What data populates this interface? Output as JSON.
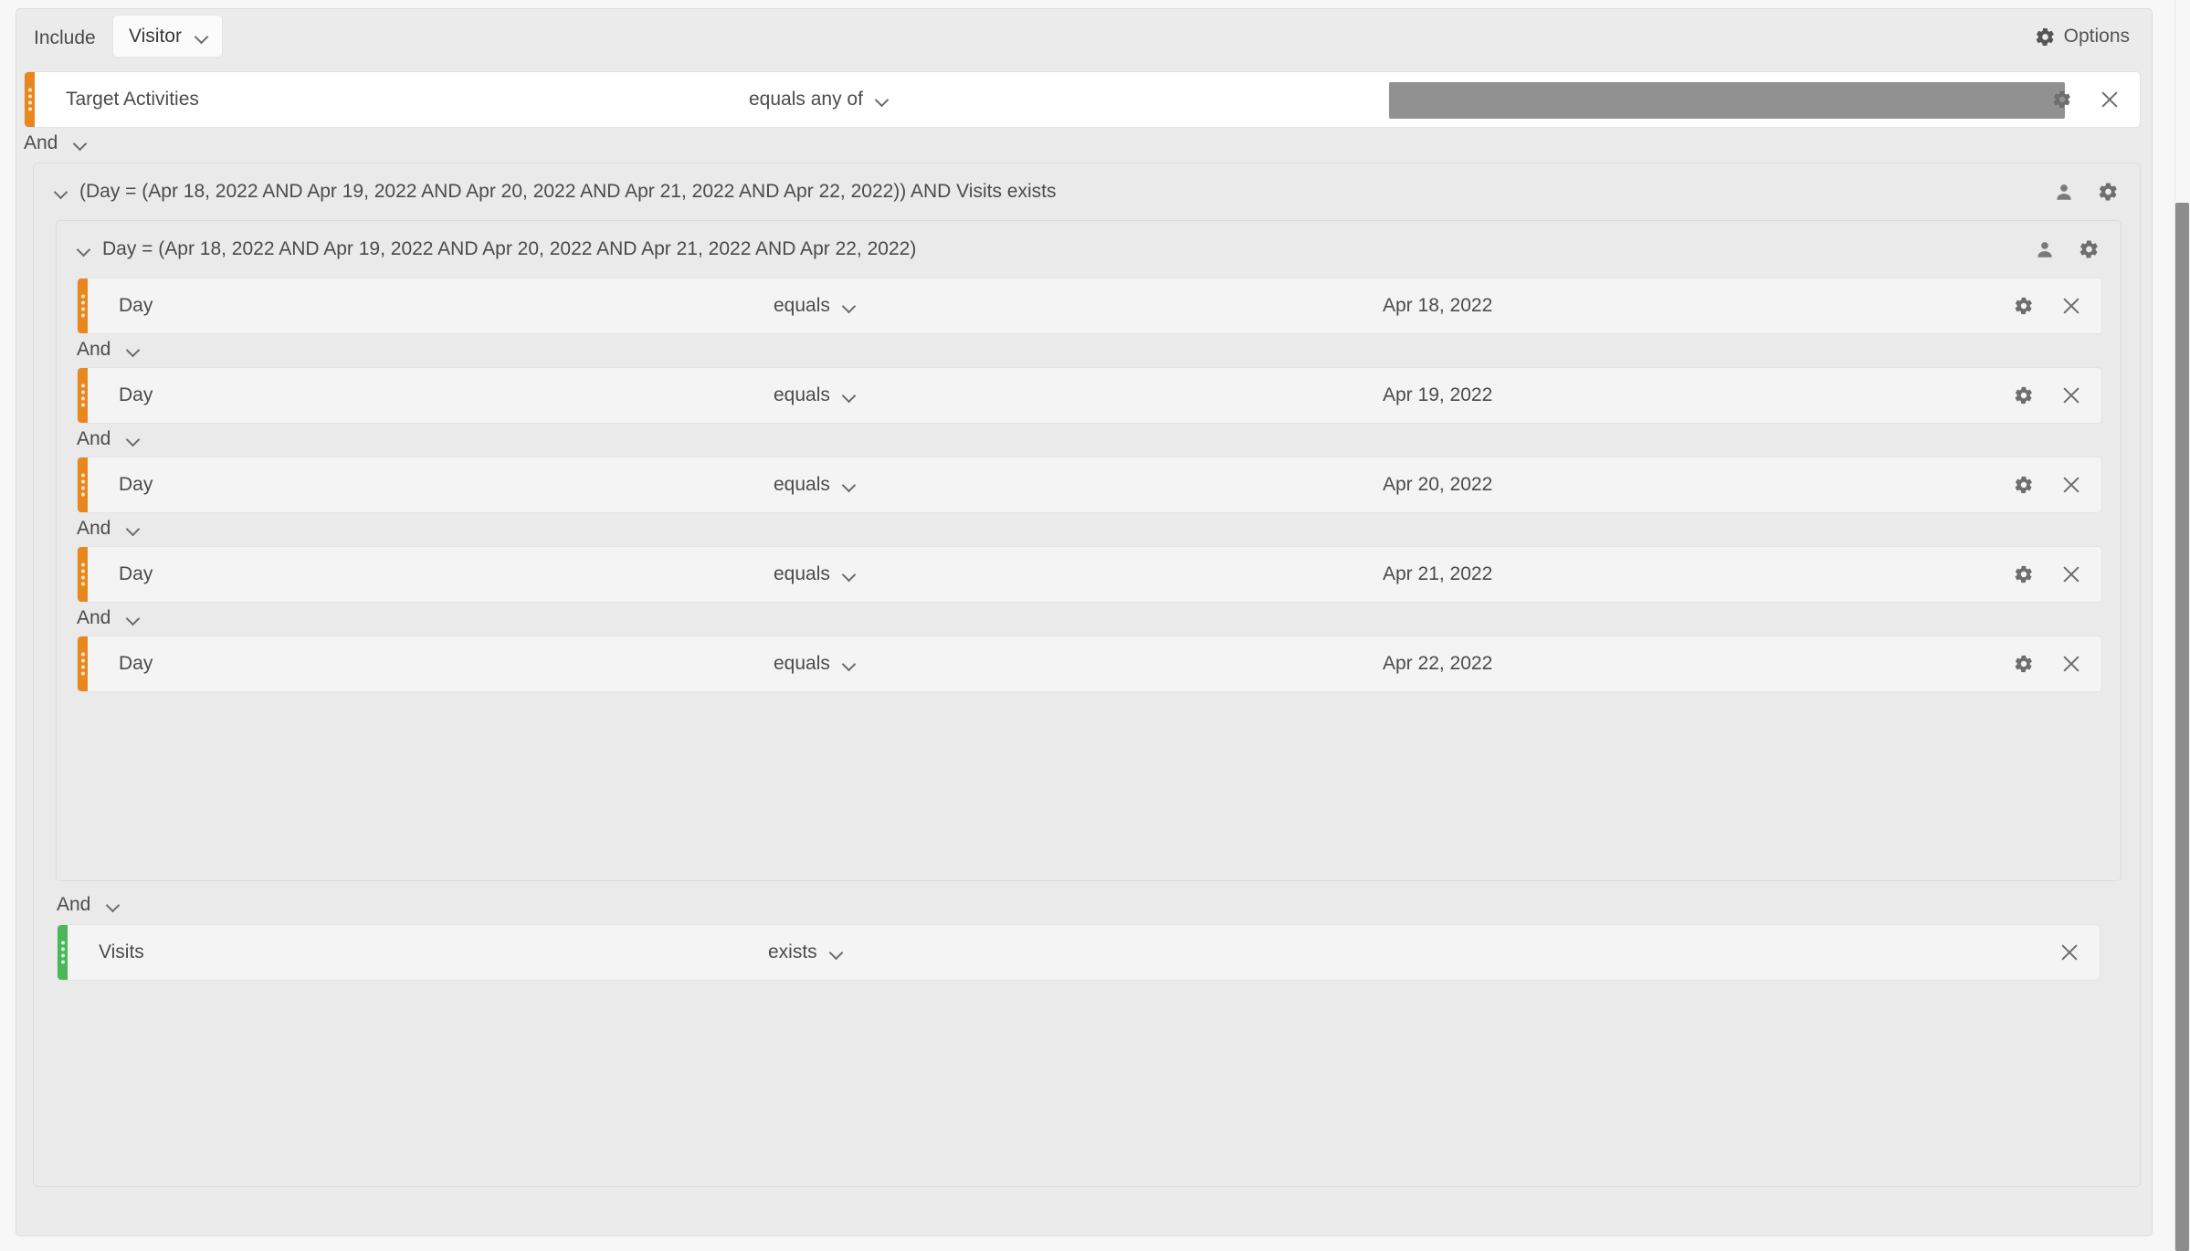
{
  "header": {
    "include_label": "Include",
    "container_value": "Visitor",
    "container_chevron_icon": "chevron-down-icon",
    "options_label": "Options",
    "options_icon": "gear-icon"
  },
  "colors": {
    "orange_bar": "#e8871e",
    "green_bar": "#4bb75a",
    "panel_bg": "#ebebeb",
    "group_bg": "#eaeaea",
    "row_bg": "#ffffff",
    "subrow_bg": "#f4f4f4",
    "redacted_box": "#919191"
  },
  "top_rule": {
    "dimension": "Target Activities",
    "operator": "equals any of",
    "operator_chevron_icon": "chevron-down-icon",
    "value_redacted": true,
    "settings_icon": "gear-icon",
    "remove_icon": "close-icon"
  },
  "connector_top": {
    "label": "And",
    "chevron_icon": "chevron-down-icon"
  },
  "outer_group": {
    "collapse_icon": "chevron-down-icon",
    "title": "(Day = (Apr 18, 2022 AND Apr 19, 2022 AND Apr 20, 2022 AND Apr 21, 2022 AND Apr 22, 2022)) AND Visits exists",
    "person_icon": "person-icon",
    "settings_icon": "gear-icon"
  },
  "inner_group": {
    "collapse_icon": "chevron-down-icon",
    "title": "Day = (Apr 18, 2022 AND Apr 19, 2022 AND Apr 20, 2022 AND Apr 21, 2022 AND Apr 22, 2022)",
    "person_icon": "person-icon",
    "settings_icon": "gear-icon"
  },
  "day_rules": [
    {
      "dimension": "Day",
      "operator": "equals",
      "value": "Apr 18, 2022",
      "settings_icon": "gear-icon",
      "remove_icon": "close-icon",
      "connector": "And"
    },
    {
      "dimension": "Day",
      "operator": "equals",
      "value": "Apr 19, 2022",
      "settings_icon": "gear-icon",
      "remove_icon": "close-icon",
      "connector": "And"
    },
    {
      "dimension": "Day",
      "operator": "equals",
      "value": "Apr 20, 2022",
      "settings_icon": "gear-icon",
      "remove_icon": "close-icon",
      "connector": "And"
    },
    {
      "dimension": "Day",
      "operator": "equals",
      "value": "Apr 21, 2022",
      "settings_icon": "gear-icon",
      "remove_icon": "close-icon",
      "connector": "And"
    },
    {
      "dimension": "Day",
      "operator": "equals",
      "value": "Apr 22, 2022",
      "settings_icon": "gear-icon",
      "remove_icon": "close-icon",
      "connector": null
    }
  ],
  "connector_inner_bottom": {
    "label": "And",
    "chevron_icon": "chevron-down-icon"
  },
  "visits_rule": {
    "dimension": "Visits",
    "operator": "exists",
    "operator_chevron_icon": "chevron-down-icon",
    "remove_icon": "close-icon"
  },
  "scrollbar": {
    "orientation": "vertical",
    "position": "right"
  }
}
